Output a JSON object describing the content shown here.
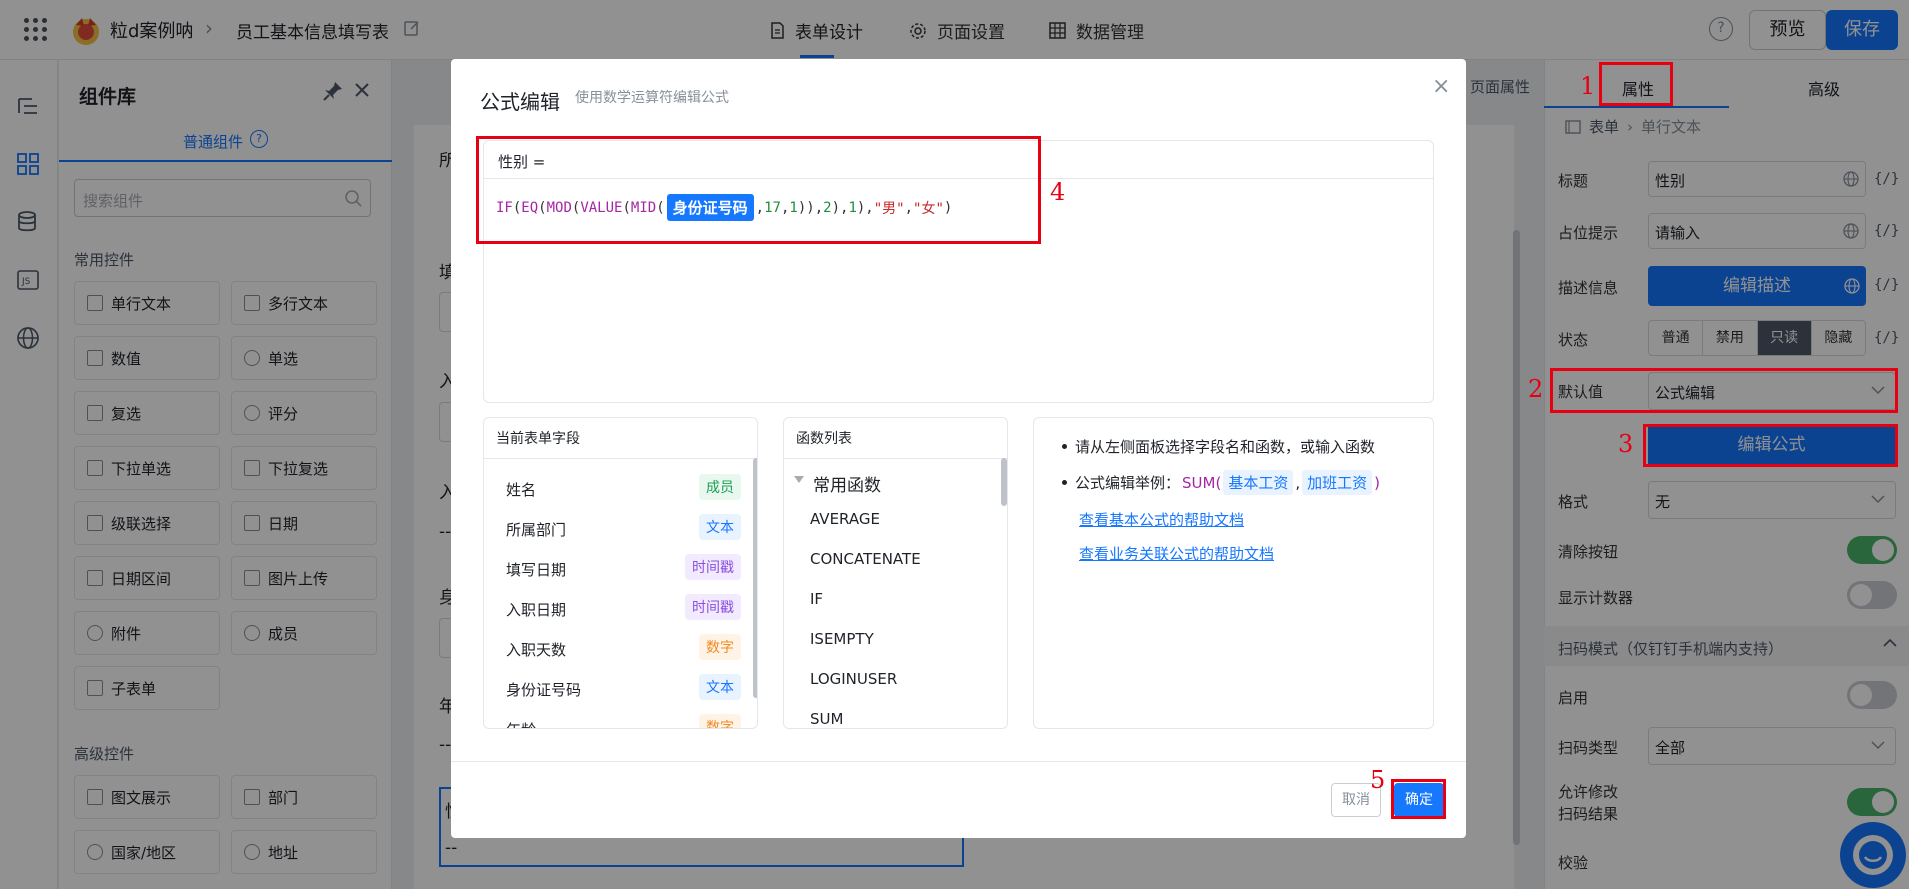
{
  "topbar": {
    "app_name": "粒d案例呐",
    "form_name": "员工基本信息填写表",
    "tabs": [
      {
        "label": "表单设计",
        "icon": "document-icon"
      },
      {
        "label": "页面设置",
        "icon": "gear-icon"
      },
      {
        "label": "数据管理",
        "icon": "table-icon"
      }
    ],
    "help": "?",
    "preview_label": "预览",
    "save_label": "保存"
  },
  "complib": {
    "title": "组件库",
    "tab_label": "普通组件",
    "search_placeholder": "搜索组件",
    "common_title": "常用控件",
    "common": [
      "单行文本",
      "多行文本",
      "数值",
      "单选",
      "复选",
      "评分",
      "下拉单选",
      "下拉复选",
      "级联选择",
      "日期",
      "日期区间",
      "图片上传",
      "附件",
      "成员",
      "子表单"
    ],
    "advanced_title": "高级控件",
    "advanced": [
      "图文展示",
      "部门",
      "国家/地区",
      "地址"
    ]
  },
  "canvas": {
    "page_props_label": "页面属性",
    "frag": [
      "所",
      "填",
      "入",
      "入",
      "--",
      "身",
      "年",
      "--",
      "性",
      "--"
    ]
  },
  "props": {
    "tab_attr": "属性",
    "tab_adv": "高级",
    "crumb_root": "表单",
    "crumb_leaf": "单行文本",
    "fx": "{/}",
    "title_label": "标题",
    "title_value": "性别",
    "placeholder_label": "占位提示",
    "placeholder_value": "请输入",
    "desc_label": "描述信息",
    "desc_button": "编辑描述",
    "state_label": "状态",
    "states": [
      "普通",
      "禁用",
      "只读",
      "隐藏"
    ],
    "state_selected": "只读",
    "default_label": "默认值",
    "default_value": "公式编辑",
    "edit_formula": "编辑公式",
    "format_label": "格式",
    "format_value": "无",
    "clear_btn_label": "清除按钮",
    "clear_btn_on": true,
    "counter_label": "显示计数器",
    "counter_on": false,
    "scan_section": "扫码模式（仅钉钉手机端内支持）",
    "enable_label": "启用",
    "enable_on": false,
    "scan_type_label": "扫码类型",
    "scan_type_value": "全部",
    "allow_edit_label_1": "允许修改",
    "allow_edit_label_2": "扫码结果",
    "allow_edit_on": true,
    "validate_section": "校验"
  },
  "modal": {
    "title": "公式编辑",
    "subtitle": "使用数学运算符编辑公式",
    "close": "×",
    "editor_head": "性别 =",
    "formula": {
      "f1": "IF",
      "p1": "(",
      "f2": "EQ",
      "p2": "(",
      "f3": "MOD",
      "p3": "(",
      "f4": "VALUE",
      "p4": "(",
      "f5": "MID",
      "p5": "(",
      "field": "身份证号码",
      "p6": ",",
      "n1": "17",
      "p7": ",",
      "n2": "1",
      "p8": ")),",
      "n3": "2",
      "p9": "),",
      "n4": "1",
      "p10": "),",
      "s1": "\"男\"",
      "p11": ",",
      "s2": "\"女\"",
      "p12": ")"
    },
    "fields_title": "当前表单字段",
    "fields": [
      {
        "name": "姓名",
        "type": "成员",
        "color": "green"
      },
      {
        "name": "所属部门",
        "type": "文本",
        "color": "blue"
      },
      {
        "name": "填写日期",
        "type": "时间戳",
        "color": "purple"
      },
      {
        "name": "入职日期",
        "type": "时间戳",
        "color": "purple"
      },
      {
        "name": "入职天数",
        "type": "数字",
        "color": "orange"
      },
      {
        "name": "身份证号码",
        "type": "文本",
        "color": "blue"
      },
      {
        "name": "年龄",
        "type": "数字",
        "color": "orange"
      }
    ],
    "funcs_title": "函数列表",
    "func_group": "常用函数",
    "funcs": [
      "AVERAGE",
      "CONCATENATE",
      "IF",
      "ISEMPTY",
      "LOGINUSER",
      "SUM"
    ],
    "tip1": "请从左侧面板选择字段名和函数，或输入函数",
    "tip2_prefix": "公式编辑举例：",
    "tip2_fn": "SUM(",
    "tip2_a": "基本工资",
    "tip2_sep": ",",
    "tip2_b": "加班工资",
    "tip2_end": ")",
    "link1": "查看基本公式的帮助文档",
    "link2": "查看业务关联公式的帮助文档",
    "cancel": "取消",
    "ok": "确定"
  },
  "annotations": [
    "1",
    "2",
    "3",
    "4",
    "5"
  ],
  "colors": {
    "accent": "#1677ff",
    "annotation": "#e60012"
  }
}
